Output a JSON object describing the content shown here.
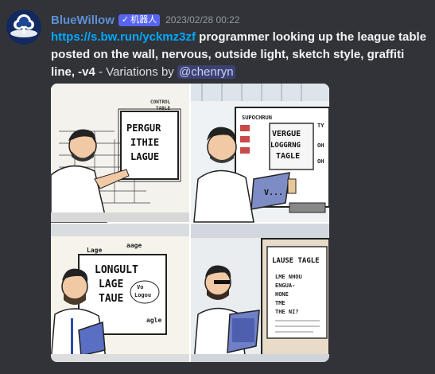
{
  "message": {
    "author": "BlueWillow",
    "bot_badge": "机器人",
    "badge_check": "✓",
    "timestamp": "2023/02/28 00:22",
    "link": "https://s.bw.run/yckmz3zf",
    "prompt": " programmer looking up the league table posted on the wall, nervous, outside light, sketch style, graffiti line, -v4",
    "variations_text": " - Variations by ",
    "mention": "@chenryn"
  },
  "image_grid": {
    "panels": [
      {
        "board_text": [
          "PERGUR",
          "ITHIE",
          "LAGUE"
        ],
        "side_text": [
          "CONTROL",
          "TABLE"
        ]
      },
      {
        "board_text": [
          "VERGUE",
          "LOGGRNG",
          "TAGLE"
        ],
        "side_text": [
          "SUPOCHRUN",
          "TY",
          "OH",
          "OH"
        ],
        "laptop_text": "V..."
      },
      {
        "board_text": [
          "LONGULT",
          "LAGE",
          "TAUE"
        ],
        "side_text": [
          "Lage",
          "aage",
          "Vo",
          "Logou",
          "agle"
        ]
      },
      {
        "board_text": [
          "LAUSE TAGLE",
          "LME NHOU",
          "ENGUA-",
          "HONE",
          "TME",
          "THE NI?"
        ]
      }
    ]
  },
  "colors": {
    "background": "#313338",
    "username": "#5d91d6",
    "link": "#00a8fc",
    "badge": "#5865f2",
    "mention_bg": "#3c4270"
  }
}
